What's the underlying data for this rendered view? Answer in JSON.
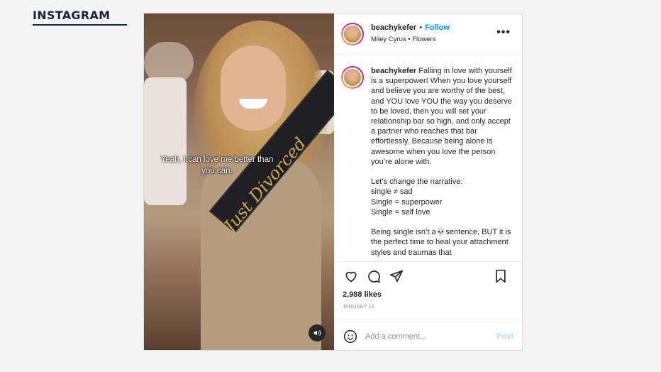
{
  "brand": {
    "name": "INSTAGRAM",
    "color": "#1a2340"
  },
  "media": {
    "overlay_caption": "Yeah, I can love me better than you can.",
    "sash_text": "Just Divorced",
    "mute_icon": "speaker-icon"
  },
  "header": {
    "username": "beachykefer",
    "separator": "•",
    "follow_label": "Follow",
    "audio": "Miley Cyrus • Flowers",
    "more_label": "•••"
  },
  "caption": {
    "username": "beachykefer",
    "text": " Falling in love with yourself is a superpower! When you love yourself and believe you are worthy of the best, and YOU love YOU the way you deserve to be loved, then you will set your relationship bar so high, and only accept a partner who reaches that bar effortlessly. Because being alone is awesome when you love the person you’re alone with.\n\nLet’s change the narrative:\nsingle ≠ sad\nSingle = superpower\nSingle = self love\n\nBeing single isn’t a💀sentence, BUT it is the perfect time to heal your attachment styles and traumas that"
  },
  "actions": {
    "icons": [
      "heart-icon",
      "comment-icon",
      "share-icon",
      "bookmark-icon"
    ]
  },
  "likes": "2,988 likes",
  "date": "JANUARY 15",
  "comment_bar": {
    "placeholder": "Add a comment...",
    "post_label": "Post"
  },
  "colors": {
    "follow": "#0095f6",
    "post_disabled": "#b3dbff"
  }
}
